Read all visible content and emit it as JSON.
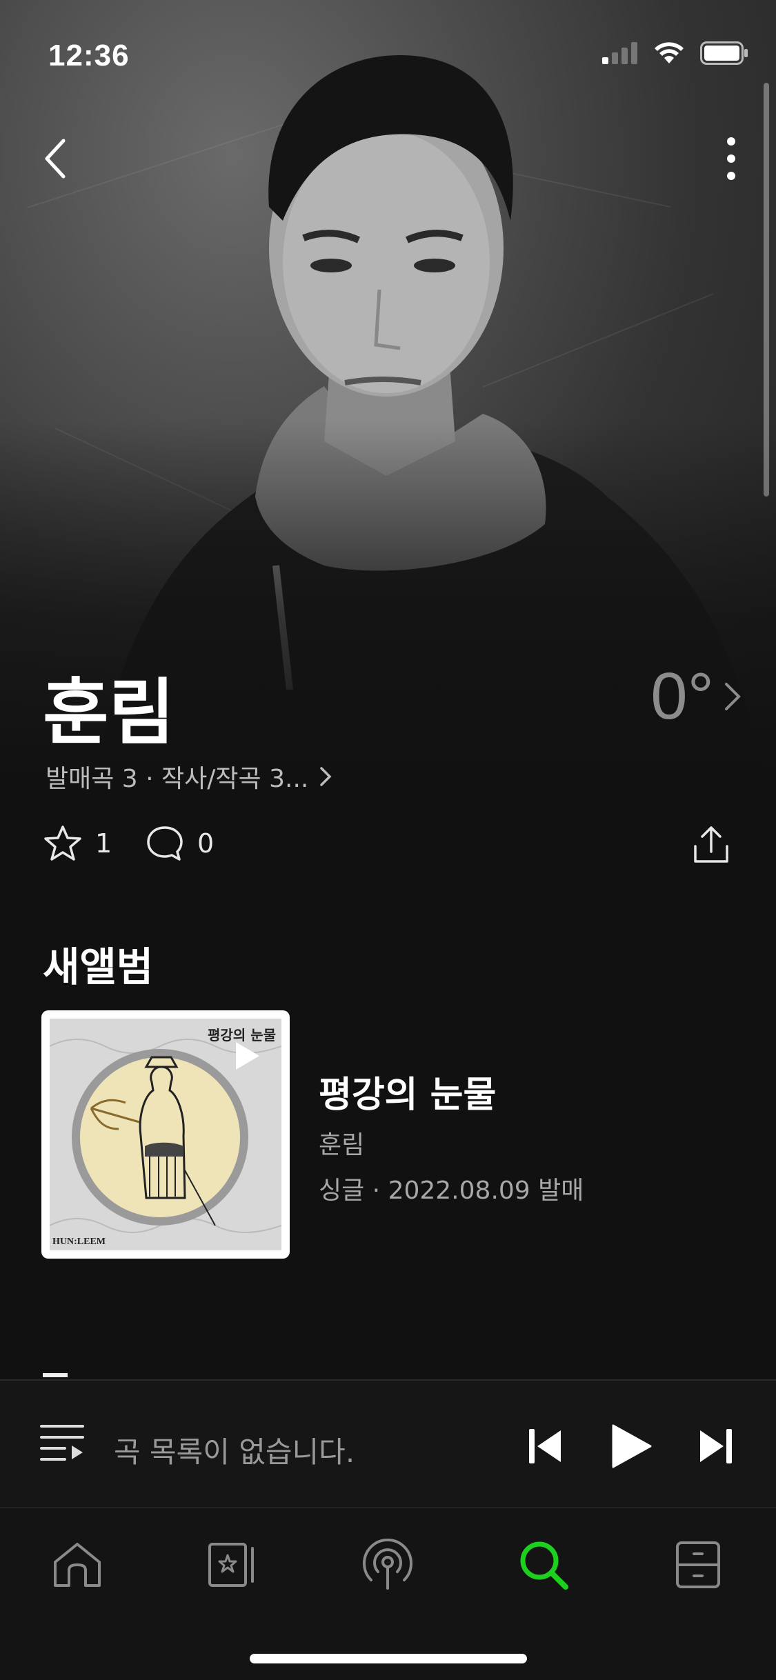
{
  "status": {
    "time": "12:36"
  },
  "artist": {
    "name": "훈림",
    "temperature": "0°",
    "meta": "발매곡 3 · 작사/작곡 3...",
    "likes": "1",
    "comments": "0"
  },
  "new_album": {
    "section_title": "새앨범",
    "title": "평강의 눈물",
    "artist": "훈림",
    "release": "싱글 · 2022.08.09 발매",
    "cover_text_top": "평강의 눈물",
    "cover_text_bottom": "HUN:LEEM"
  },
  "player": {
    "message": "곡 목록이 없습니다."
  },
  "tabs": [
    "home",
    "library",
    "podcast",
    "search",
    "storage"
  ],
  "colors": {
    "accent": "#1ed01e",
    "background": "#111111",
    "muted": "#a8a8a8"
  },
  "icons": [
    "chevron-left-icon",
    "more-vertical-icon",
    "chevron-right-icon",
    "star-icon",
    "comment-icon",
    "share-icon",
    "play-icon",
    "queue-icon",
    "skip-previous-icon",
    "skip-next-icon",
    "home-icon",
    "library-icon",
    "podcast-icon",
    "search-icon",
    "storage-icon"
  ]
}
